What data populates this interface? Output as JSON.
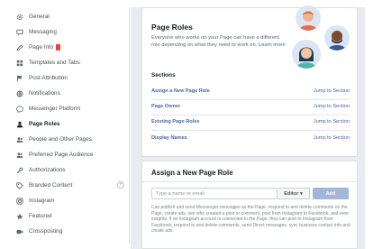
{
  "sidebar": {
    "items": [
      {
        "label": "General",
        "icon": "gear-icon"
      },
      {
        "label": "Messaging",
        "icon": "chat-icon"
      },
      {
        "label": "Page Info",
        "icon": "pencil-icon",
        "badge": true
      },
      {
        "label": "Templates and Tabs",
        "icon": "grid-icon"
      },
      {
        "label": "Post Attribution",
        "icon": "flag-icon"
      },
      {
        "label": "Notifications",
        "icon": "globe-icon"
      },
      {
        "label": "Messenger Platform",
        "icon": "messenger-icon"
      },
      {
        "label": "Page Roles",
        "icon": "person-icon",
        "active": true
      },
      {
        "label": "People and Other Pages",
        "icon": "people-icon"
      },
      {
        "label": "Preferred Page Audience",
        "icon": "people-icon"
      },
      {
        "label": "Authorizations",
        "icon": "wrench-icon"
      },
      {
        "label": "Branded Content",
        "icon": "tag-icon",
        "expand": true
      },
      {
        "label": "Instagram",
        "icon": "instagram-icon"
      },
      {
        "label": "Featured",
        "icon": "star-icon"
      },
      {
        "label": "Crossposting",
        "icon": "video-icon"
      }
    ]
  },
  "page_roles": {
    "title": "Page Roles",
    "description": "Everyone who works on your Page can have a different role depending on what they need to work on.",
    "learn_more": "Learn more"
  },
  "sections": {
    "label": "Sections",
    "jump_label": "Jump to Section",
    "links": [
      "Assign a New Page Role",
      "Page Owner",
      "Existing Page Roles",
      "Display Names"
    ]
  },
  "assign": {
    "title": "Assign a New Page Role",
    "input_placeholder": "Type a name or email",
    "role_value": "Editor ▾",
    "add_label": "Add",
    "body": "Can publish and send Messenger messages as the Page, respond to and delete comments on the Page, create ads, see who created a post or comment, post from Instagram to Facebook, and view insights. If an Instagram account is connected to the Page, they can post to Instagram from Facebook, respond to and delete comments, send Direct messages, sync business contact info and create ads."
  },
  "colors": {
    "accent": "#4267b2",
    "sidebar_border": "#dddfe2",
    "main_background": "#e9ebee",
    "add_button": "#a4b6d8",
    "badge": "#e9463a"
  }
}
